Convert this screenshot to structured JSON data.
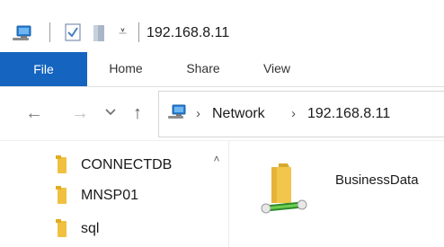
{
  "title_bar": {
    "title": "192.168.8.11",
    "qa_dropdown_glyph": "⩡",
    "icons": [
      "network-computer-icon",
      "properties-check-icon",
      "new-folder-icon",
      "quick-access-dropdown-icon"
    ]
  },
  "ribbon": {
    "tabs": [
      {
        "label": "File",
        "active": true
      },
      {
        "label": "Home"
      },
      {
        "label": "Share"
      },
      {
        "label": "View"
      }
    ]
  },
  "navigation": {
    "back_glyph": "←",
    "forward_glyph": "→",
    "recent_glyph": "⌵",
    "up_glyph": "↑",
    "breadcrumb": [
      "Network",
      "192.168.8.11"
    ],
    "separator": "›"
  },
  "nav_pane": {
    "items": [
      {
        "label": "CONNECTDB"
      },
      {
        "label": "MNSP01"
      },
      {
        "label": "sql"
      }
    ],
    "scroll_up_glyph": "˄"
  },
  "content": {
    "items": [
      {
        "label": "BusinessData",
        "icon": "shared-folder-icon"
      }
    ]
  },
  "colors": {
    "file_tab_bg": "#1565c0",
    "folder_yellow": "#f0c040",
    "share_green": "#3aa63a"
  }
}
